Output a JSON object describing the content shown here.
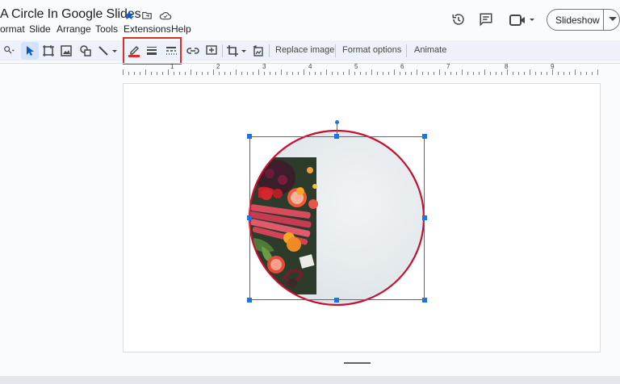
{
  "doc": {
    "title": "A Circle In Google Slides"
  },
  "menu": [
    "ormat",
    "Slide",
    "Arrange",
    "Tools",
    "Extensions",
    "Help"
  ],
  "header_buttons": {
    "slideshow_label": "Slideshow"
  },
  "toolbar": {
    "replace_image": "Replace image",
    "format_options": "Format options",
    "animate": "Animate"
  },
  "ruler": {
    "numbers": [
      "1",
      "2",
      "3",
      "4",
      "5",
      "6",
      "7",
      "8",
      "9"
    ]
  },
  "colors": {
    "accent_blue": "#0b57d0",
    "highlight_red": "#d93025",
    "circle_border": "#c8102e"
  },
  "icons": [
    "star-icon",
    "move-to-folder-icon",
    "cloud-saved-icon",
    "history-icon",
    "comment-icon",
    "video-camera-icon",
    "zoom-icon",
    "select-cursor-icon",
    "frame-icon",
    "image-icon",
    "shapes-icon",
    "line-icon",
    "border-color-pen-icon",
    "border-weight-icon",
    "border-dash-icon",
    "link-icon",
    "add-comment-icon",
    "crop-icon",
    "reset-image-icon"
  ]
}
